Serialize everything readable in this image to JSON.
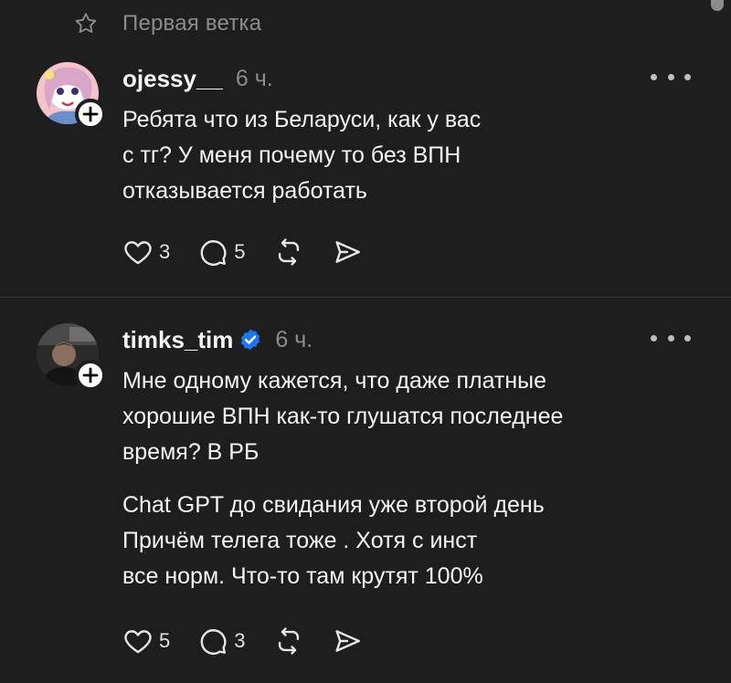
{
  "thread": {
    "header_label": "Первая ветка"
  },
  "posts": [
    {
      "username": "ojessy__",
      "verified": false,
      "time": "6 ч.",
      "text": "Ребята что из Беларуси, как у вас\nс тг? У меня почему то без ВПН\nотказывается работать",
      "likes": "3",
      "replies": "5"
    },
    {
      "username": "timks_tim",
      "verified": true,
      "time": "6 ч.",
      "text": "Мне одному кажется, что даже платные\nхорошие ВПН как-то глушатся последнее\nвремя? В РБ",
      "text_2": "Chat GPT до свидания уже второй день\nПричём телега тоже . Хотя с инст\nвсе норм. Что-то там крутят 100%",
      "likes": "5",
      "replies": "3"
    }
  ],
  "colors": {
    "background": "#1e1e1e",
    "text_primary": "#f3f5f7",
    "text_secondary": "#8c8c8c",
    "verified_blue": "#1877f2"
  },
  "icons": {
    "header": "star-outline-icon",
    "actions": [
      "heart-icon",
      "comment-icon",
      "repost-icon",
      "share-icon"
    ],
    "follow": "plus-icon",
    "menu": "more-dots-icon",
    "badge": "verified-badge-icon"
  }
}
